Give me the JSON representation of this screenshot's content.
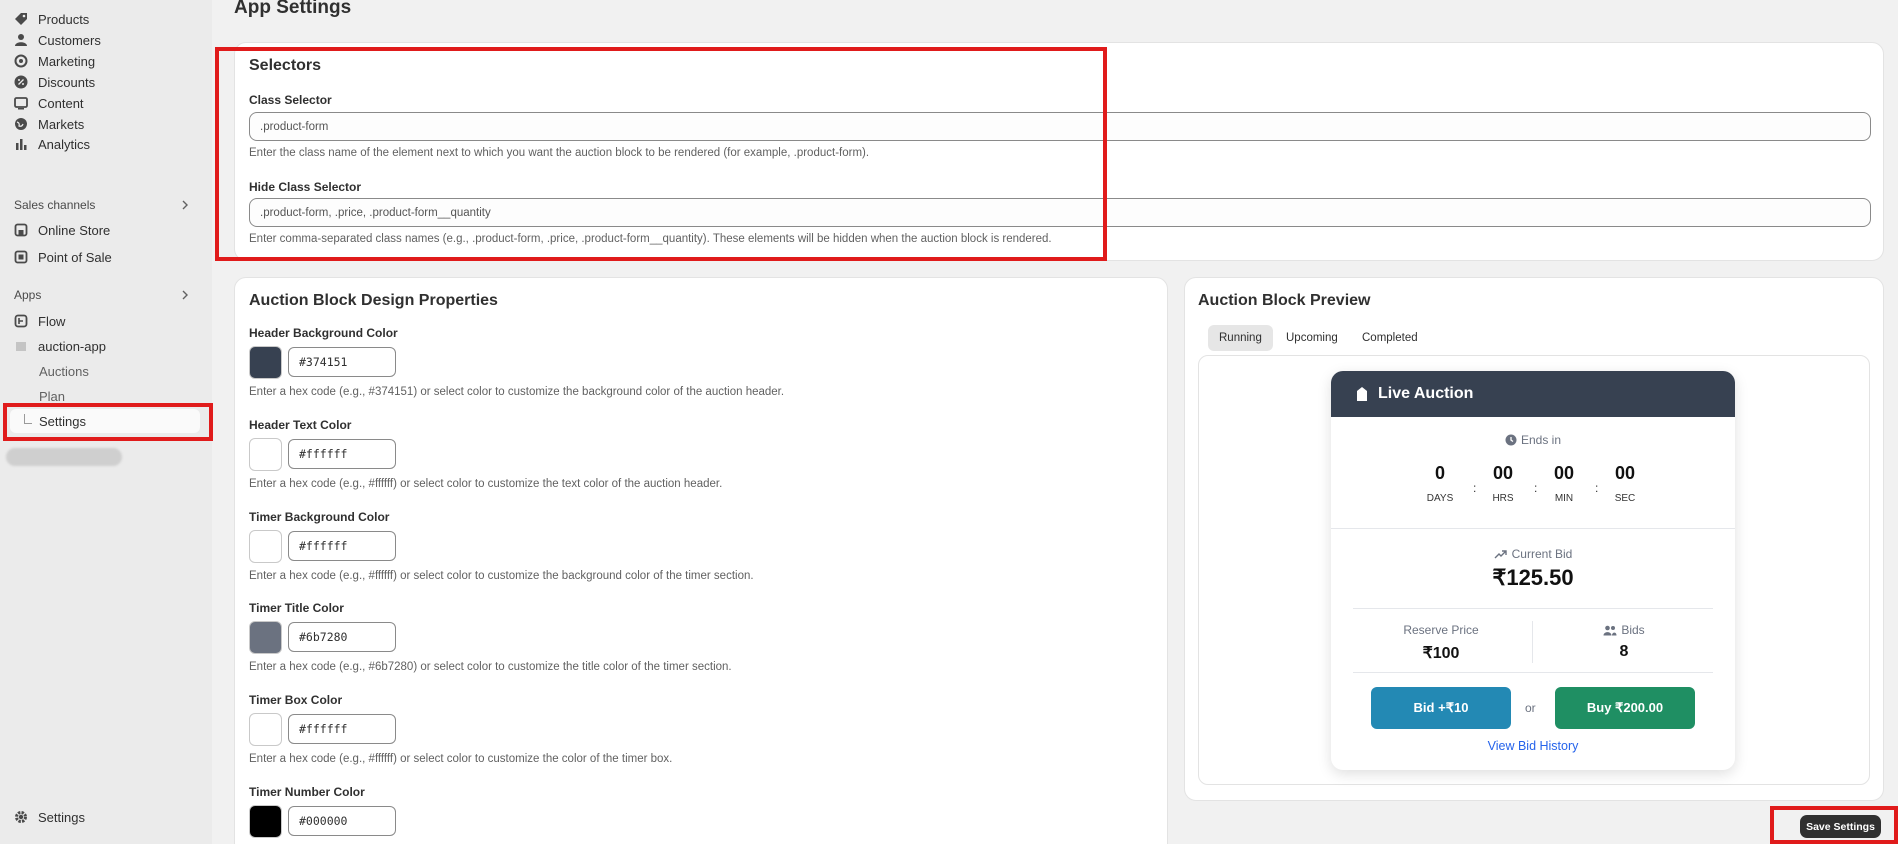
{
  "sidebar": {
    "items": [
      {
        "label": "Products",
        "icon": "tag-icon"
      },
      {
        "label": "Customers",
        "icon": "person-icon"
      },
      {
        "label": "Marketing",
        "icon": "target-icon"
      },
      {
        "label": "Discounts",
        "icon": "discount-icon"
      },
      {
        "label": "Content",
        "icon": "content-icon"
      },
      {
        "label": "Markets",
        "icon": "globe-icon"
      },
      {
        "label": "Analytics",
        "icon": "bar-chart-icon"
      }
    ],
    "sales_channels_label": "Sales channels",
    "sales_channels": [
      {
        "label": "Online Store",
        "icon": "store-icon"
      },
      {
        "label": "Point of Sale",
        "icon": "pos-icon"
      }
    ],
    "apps_label": "Apps",
    "apps": [
      {
        "label": "Flow",
        "icon": "flow-icon"
      },
      {
        "label": "auction-app",
        "icon": "app-icon"
      }
    ],
    "app_subitems": [
      "Auctions",
      "Plan",
      "Settings"
    ],
    "settings_label": "Settings"
  },
  "page": {
    "title": "App Settings"
  },
  "selectors": {
    "title": "Selectors",
    "class_selector_label": "Class Selector",
    "class_selector_value": ".product-form",
    "class_selector_help": "Enter the class name of the element next to which you want the auction block to be rendered (for example, .product-form).",
    "hide_selector_label": "Hide Class Selector",
    "hide_selector_value": ".product-form, .price, .product-form__quantity",
    "hide_selector_help": "Enter comma-separated class names (e.g., .product-form, .price, .product-form__quantity). These elements will be hidden when the auction block is rendered."
  },
  "design": {
    "title": "Auction Block Design Properties",
    "fields": [
      {
        "label": "Header Background Color",
        "value": "#374151",
        "color": "#374151",
        "help": "Enter a hex code (e.g., #374151) or select color to customize the background color of the auction header."
      },
      {
        "label": "Header Text Color",
        "value": "#ffffff",
        "color": "#ffffff",
        "help": "Enter a hex code (e.g., #ffffff) or select color to customize the text color of the auction header."
      },
      {
        "label": "Timer Background Color",
        "value": "#ffffff",
        "color": "#ffffff",
        "help": "Enter a hex code (e.g., #ffffff) or select color to customize the background color of the timer section."
      },
      {
        "label": "Timer Title Color",
        "value": "#6b7280",
        "color": "#6b7280",
        "help": "Enter a hex code (e.g., #6b7280) or select color to customize the title color of the timer section."
      },
      {
        "label": "Timer Box Color",
        "value": "#ffffff",
        "color": "#ffffff",
        "help": "Enter a hex code (e.g., #ffffff) or select color to customize the color of the timer box."
      },
      {
        "label": "Timer Number Color",
        "value": "#000000",
        "color": "#000000",
        "help": ""
      }
    ]
  },
  "preview": {
    "title": "Auction Block Preview",
    "tabs": [
      "Running",
      "Upcoming",
      "Completed"
    ],
    "widget": {
      "header_title": "Live Auction",
      "ends_in_label": "Ends in",
      "timer": [
        {
          "value": "0",
          "label": "DAYS"
        },
        {
          "value": "00",
          "label": "HRS"
        },
        {
          "value": "00",
          "label": "MIN"
        },
        {
          "value": "00",
          "label": "SEC"
        }
      ],
      "timer_sep": ":",
      "current_bid_label": "Current Bid",
      "current_bid_value": "₹125.50",
      "reserve_label": "Reserve Price",
      "reserve_value": "₹100",
      "bids_label": "Bids",
      "bids_value": "8",
      "bid_button": "Bid +₹10",
      "or_text": "or",
      "buy_button": "Buy ₹200.00",
      "history_link": "View Bid History"
    }
  },
  "actions": {
    "save_label": "Save Settings"
  },
  "colors": {
    "accent_red": "#e01b1b",
    "bid_button": "#2389b4",
    "buy_button": "#1f8f63",
    "link": "#2563eb"
  }
}
